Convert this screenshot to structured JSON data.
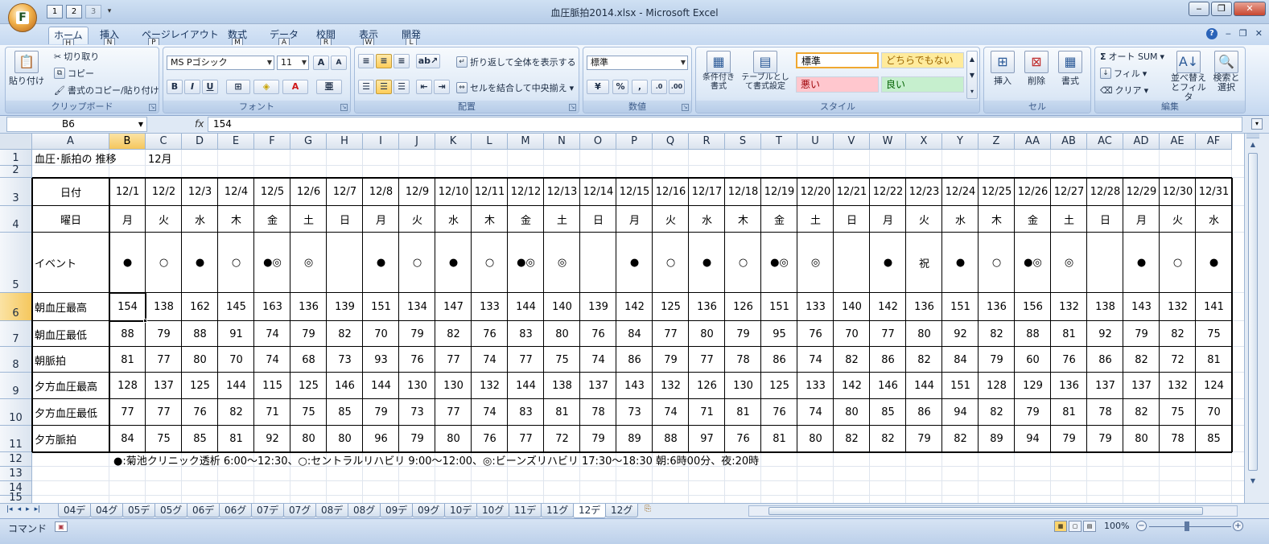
{
  "window": {
    "title": "血圧脈拍2014.xlsx - Microsoft Excel",
    "office_button_letter": "F",
    "qat_keys": [
      "1",
      "2",
      "3"
    ],
    "buttons": [
      "‒",
      "❐",
      "✕"
    ]
  },
  "ribbon_tabs": [
    {
      "label": "ホーム",
      "key": "H",
      "active": true
    },
    {
      "label": "挿入",
      "key": "N"
    },
    {
      "label": "ページレイアウト",
      "key": "P"
    },
    {
      "label": "数式",
      "key": "M"
    },
    {
      "label": "データ",
      "key": "A"
    },
    {
      "label": "校閲",
      "key": "R"
    },
    {
      "label": "表示",
      "key": "W"
    },
    {
      "label": "開発",
      "key": "L"
    }
  ],
  "ribbon": {
    "clipboard": {
      "label": "クリップボード",
      "paste": "貼り付け",
      "cut": "切り取り",
      "copy": "コピー",
      "format_painter": "書式のコピー/貼り付け"
    },
    "font": {
      "label": "フォント",
      "font_name": "MS Pゴシック",
      "font_size": "11",
      "bold": "B",
      "italic": "I",
      "underline": "U"
    },
    "alignment": {
      "label": "配置",
      "wrap": "折り返して全体を表示する",
      "merge": "セルを結合して中央揃え"
    },
    "number": {
      "label": "数値",
      "format": "標準",
      "percent": "%",
      "comma": ","
    },
    "styles": {
      "label": "スタイル",
      "conditional": "条件付き書式",
      "table": "テーブルとして書式設定",
      "standard": "標準",
      "neutral": "どちらでもない",
      "bad": "悪い",
      "good": "良い"
    },
    "cells": {
      "label": "セル",
      "insert": "挿入",
      "delete": "削除",
      "format": "書式"
    },
    "editing": {
      "label": "編集",
      "autosum": "オート SUM",
      "fill": "フィル",
      "clear": "クリア",
      "sort": "並べ替えとフィルタ",
      "find": "検索と選択"
    },
    "colors": {
      "bad_bg": "#ffc7ce",
      "bad_fg": "#9c0006",
      "good_bg": "#c6efce",
      "good_fg": "#006100",
      "neutral_bg": "#ffeb9c",
      "neutral_fg": "#9c6500"
    }
  },
  "formula_bar": {
    "name_box": "B6",
    "fx": "fx",
    "content": "154"
  },
  "columns": [
    "A",
    "B",
    "C",
    "D",
    "E",
    "F",
    "G",
    "H",
    "I",
    "J",
    "K",
    "L",
    "M",
    "N",
    "O",
    "P",
    "Q",
    "R",
    "S",
    "T",
    "U",
    "V",
    "W",
    "X",
    "Y",
    "Z",
    "AA",
    "AB",
    "AC",
    "AD",
    "AE",
    "AF"
  ],
  "rows": [
    "1",
    "2",
    "3",
    "4",
    "5",
    "6",
    "7",
    "8",
    "9",
    "10",
    "11",
    "12",
    "13",
    "14",
    "15"
  ],
  "sheet": {
    "title": "血圧･脈拍の 推移",
    "month": "12月",
    "row_labels": [
      "日付",
      "曜日",
      "イベント",
      "朝血圧最高",
      "朝血圧最低",
      "朝脈拍",
      "夕方血圧最高",
      "夕方血圧最低",
      "夕方脈拍"
    ],
    "dates": [
      "12/1",
      "12/2",
      "12/3",
      "12/4",
      "12/5",
      "12/6",
      "12/7",
      "12/8",
      "12/9",
      "12/10",
      "12/11",
      "12/12",
      "12/13",
      "12/14",
      "12/15",
      "12/16",
      "12/17",
      "12/18",
      "12/19",
      "12/20",
      "12/21",
      "12/22",
      "12/23",
      "12/24",
      "12/25",
      "12/26",
      "12/27",
      "12/28",
      "12/29",
      "12/30",
      "12/31"
    ],
    "weekdays": [
      "月",
      "火",
      "水",
      "木",
      "金",
      "土",
      "日",
      "月",
      "火",
      "水",
      "木",
      "金",
      "土",
      "日",
      "月",
      "火",
      "水",
      "木",
      "金",
      "土",
      "日",
      "月",
      "火",
      "水",
      "木",
      "金",
      "土",
      "日",
      "月",
      "火",
      "水"
    ],
    "events": [
      "●",
      "○",
      "●",
      "○",
      "●◎",
      "◎",
      "",
      "●",
      "○",
      "●",
      "○",
      "●◎",
      "◎",
      "",
      "●",
      "○",
      "●",
      "○",
      "●◎",
      "◎",
      "",
      "●",
      "祝",
      "●",
      "○",
      "●◎",
      "◎",
      "",
      "●",
      "○",
      "●"
    ],
    "morning_high": [
      "154",
      "138",
      "162",
      "145",
      "163",
      "136",
      "139",
      "151",
      "134",
      "147",
      "133",
      "144",
      "140",
      "139",
      "142",
      "125",
      "136",
      "126",
      "151",
      "133",
      "140",
      "142",
      "136",
      "151",
      "136",
      "156",
      "132",
      "138",
      "143",
      "132",
      "141"
    ],
    "morning_low": [
      "88",
      "79",
      "88",
      "91",
      "74",
      "79",
      "82",
      "70",
      "79",
      "82",
      "76",
      "83",
      "80",
      "76",
      "84",
      "77",
      "80",
      "79",
      "95",
      "76",
      "70",
      "77",
      "80",
      "92",
      "82",
      "88",
      "81",
      "92",
      "79",
      "82",
      "75"
    ],
    "morning_pulse": [
      "81",
      "77",
      "80",
      "70",
      "74",
      "68",
      "73",
      "93",
      "76",
      "77",
      "74",
      "77",
      "75",
      "74",
      "86",
      "79",
      "77",
      "78",
      "86",
      "74",
      "82",
      "86",
      "82",
      "84",
      "79",
      "60",
      "76",
      "86",
      "82",
      "72",
      "81"
    ],
    "evening_high": [
      "128",
      "137",
      "125",
      "144",
      "115",
      "125",
      "146",
      "144",
      "130",
      "130",
      "132",
      "144",
      "138",
      "137",
      "143",
      "132",
      "126",
      "130",
      "125",
      "133",
      "142",
      "146",
      "144",
      "151",
      "128",
      "129",
      "136",
      "137",
      "137",
      "132",
      "124"
    ],
    "evening_low": [
      "77",
      "77",
      "76",
      "82",
      "71",
      "75",
      "85",
      "79",
      "73",
      "77",
      "74",
      "83",
      "81",
      "78",
      "73",
      "74",
      "71",
      "81",
      "76",
      "74",
      "80",
      "85",
      "86",
      "94",
      "82",
      "79",
      "81",
      "78",
      "82",
      "75",
      "70"
    ],
    "evening_pulse": [
      "84",
      "75",
      "85",
      "81",
      "92",
      "80",
      "80",
      "96",
      "79",
      "80",
      "76",
      "77",
      "72",
      "79",
      "89",
      "88",
      "97",
      "76",
      "81",
      "80",
      "82",
      "82",
      "79",
      "82",
      "89",
      "94",
      "79",
      "79",
      "80",
      "78",
      "85"
    ],
    "note": "●:菊池クリニック透析  6:00～12:30、○:セントラルリハビリ  9:00～12:00、◎:ビーンズリハビリ  17:30～18:30          朝:6時00分、夜:20時"
  },
  "sheet_tabs": [
    "04デ",
    "04グ",
    "05デ",
    "05グ",
    "06デ",
    "06グ",
    "07デ",
    "07グ",
    "08デ",
    "08グ",
    "09デ",
    "09グ",
    "10デ",
    "10グ",
    "11デ",
    "11グ",
    "12デ",
    "12グ"
  ],
  "active_sheet": "12デ",
  "sheet_nav": [
    "|◂",
    "◂",
    "▸",
    "▸|"
  ],
  "status": {
    "mode": "コマンド",
    "zoom": "100%",
    "zoom_minus": "−",
    "zoom_plus": "+"
  }
}
